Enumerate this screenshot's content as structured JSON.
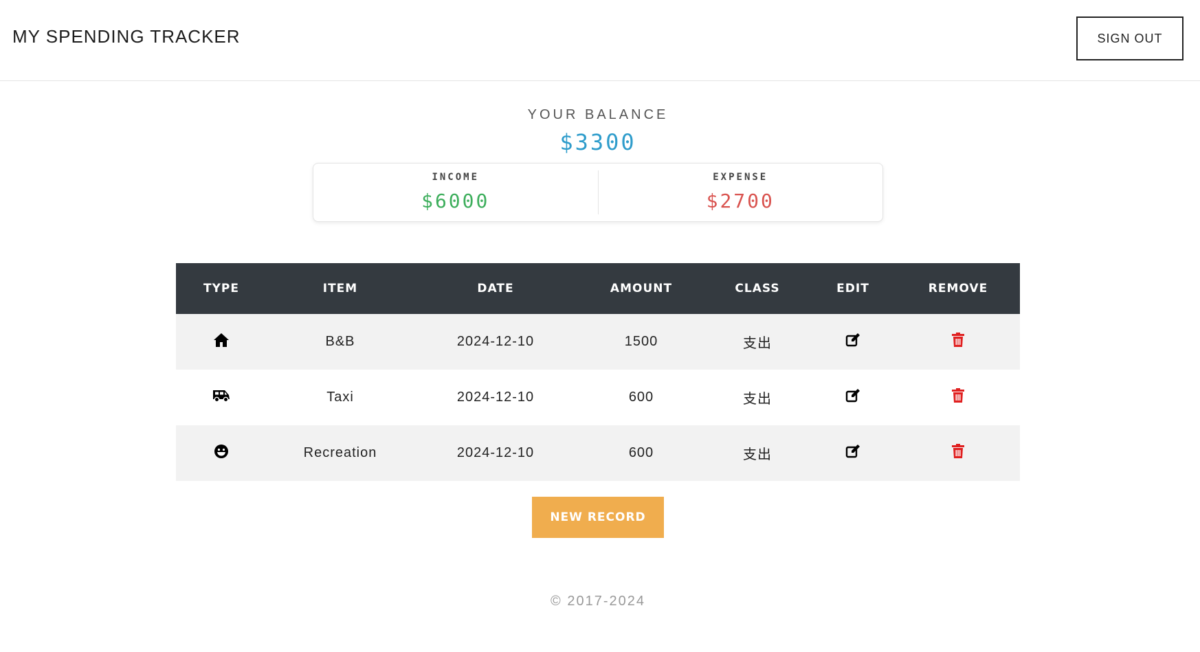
{
  "header": {
    "app_title": "MY SPENDING TRACKER",
    "sign_out_label": "SIGN OUT"
  },
  "balance": {
    "label": "YOUR BALANCE",
    "value": "$3300",
    "income_label": "INCOME",
    "income_value": "$6000",
    "expense_label": "EXPENSE",
    "expense_value": "$2700"
  },
  "table": {
    "columns": [
      "TYPE",
      "ITEM",
      "DATE",
      "AMOUNT",
      "CLASS",
      "EDIT",
      "REMOVE"
    ],
    "rows": [
      {
        "type_icon": "home-icon",
        "item": "B&B",
        "date": "2024-12-10",
        "amount": "1500",
        "class": "支出"
      },
      {
        "type_icon": "shuttle-van-icon",
        "item": "Taxi",
        "date": "2024-12-10",
        "amount": "600",
        "class": "支出"
      },
      {
        "type_icon": "grin-face-icon",
        "item": "Recreation",
        "date": "2024-12-10",
        "amount": "600",
        "class": "支出"
      }
    ]
  },
  "actions": {
    "new_record_label": "NEW RECORD"
  },
  "footer": {
    "copyright": "© 2017-2024"
  },
  "colors": {
    "balance": "#2e9ccb",
    "income": "#3dae5c",
    "expense": "#d9534f",
    "table_header": "#343a40",
    "new_record_button": "#f0ad4e",
    "remove_icon": "#e02020"
  }
}
